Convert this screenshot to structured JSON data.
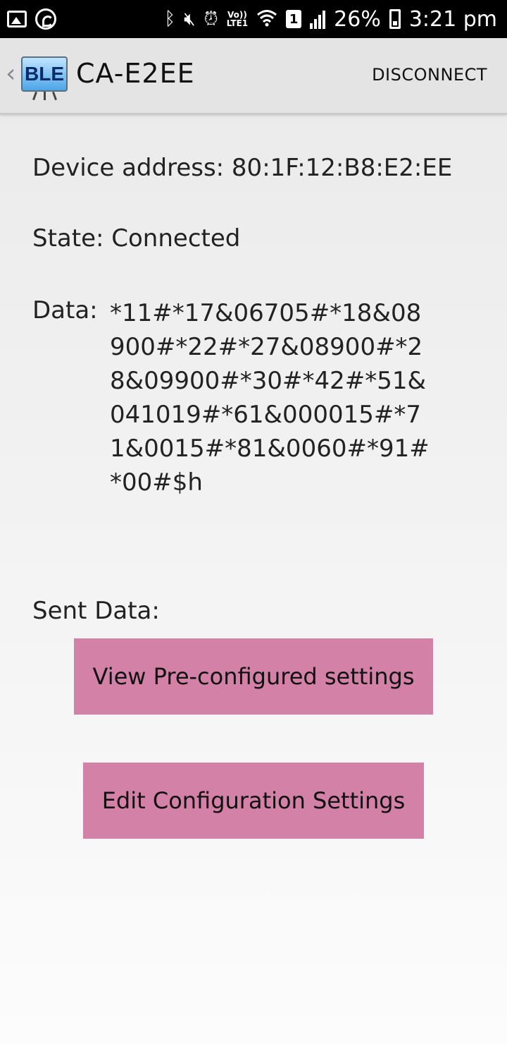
{
  "status_bar": {
    "icons_left": [
      "image-icon",
      "whatsapp-icon"
    ],
    "icons_right": [
      "bluetooth-icon",
      "mute-icon",
      "alarm-icon",
      "volte-icon",
      "wifi-icon",
      "sim-icon",
      "signal-icon",
      "battery-icon"
    ],
    "volte_top": "Vo))",
    "volte_bottom": "LTE1",
    "sim_slot": "1",
    "battery": "26%",
    "time": "3:21 pm"
  },
  "action_bar": {
    "logo_text": "BLE",
    "title": "CA-E2EE",
    "disconnect_label": "DISCONNECT"
  },
  "content": {
    "device_address": "Device address: 80:1F:12:B8:E2:EE",
    "state": "State: Connected",
    "data_label": "Data:",
    "data_value": "*11#*17&06705#*18&08900#*22#*27&08900#*28&09900#*30#*42#*51&041019#*61&000015#*71&0015#*81&0060#*91#*00#$h",
    "sent_label": "Sent Data:"
  },
  "buttons": {
    "view_label": "View Pre-configured settings",
    "edit_label": "Edit Configuration Settings"
  },
  "colors": {
    "button_bg": "#d481a8",
    "status_bar_bg": "#000000",
    "action_bar_bg": "#e4e4e4"
  }
}
